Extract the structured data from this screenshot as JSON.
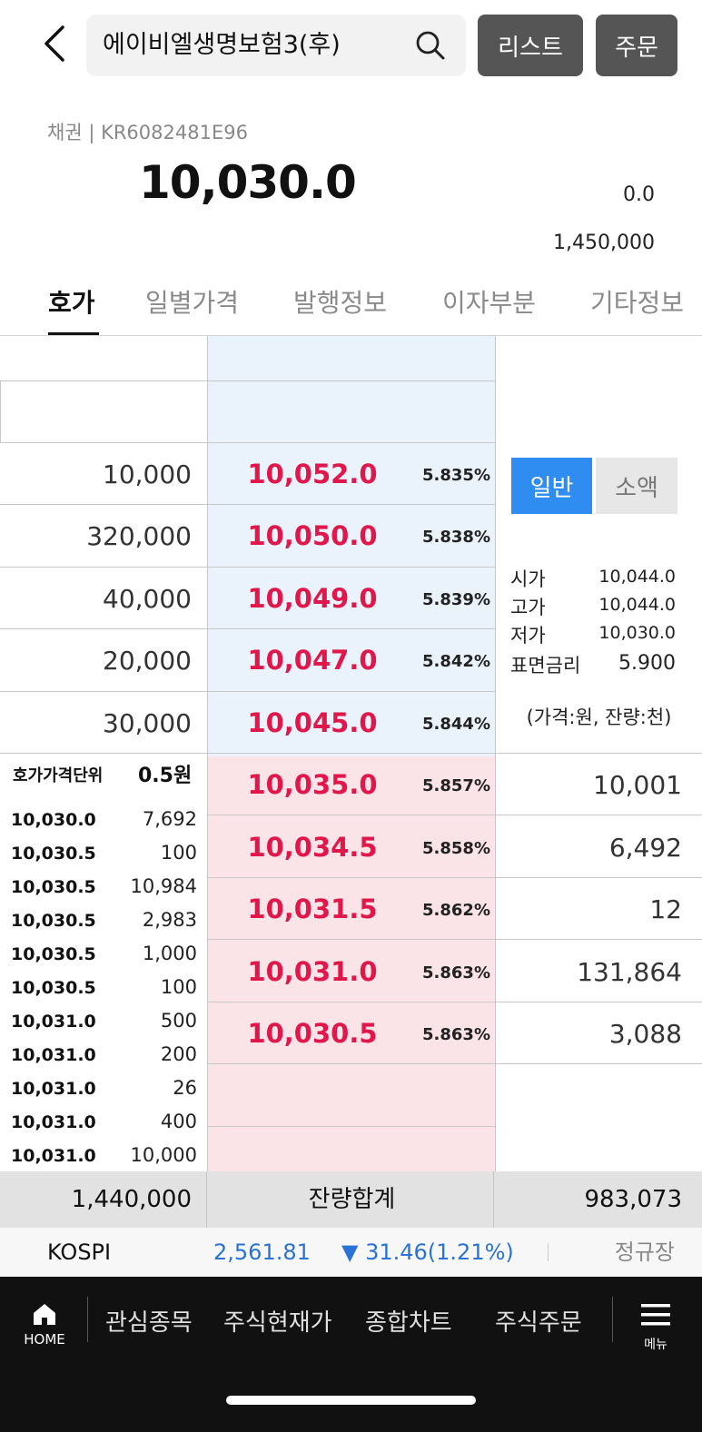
{
  "header": {
    "search_text": "에이비엘생명보험3(후)",
    "list_label": "리스트",
    "order_label": "주문"
  },
  "security": {
    "type_code": "채권 | KR6082481E96",
    "price": "10,030.0",
    "change": "0.0",
    "volume": "1,450,000"
  },
  "tabs": [
    {
      "label": "호가",
      "active": true
    },
    {
      "label": "일별가격",
      "active": false
    },
    {
      "label": "발행정보",
      "active": false
    },
    {
      "label": "이자부분",
      "active": false
    },
    {
      "label": "기타정보",
      "active": false
    }
  ],
  "asks": [
    {
      "qty": "10,000",
      "price": "10,052.0",
      "yield": "5.835%"
    },
    {
      "qty": "320,000",
      "price": "10,050.0",
      "yield": "5.838%"
    },
    {
      "qty": "40,000",
      "price": "10,049.0",
      "yield": "5.839%"
    },
    {
      "qty": "20,000",
      "price": "10,047.0",
      "yield": "5.842%"
    },
    {
      "qty": "30,000",
      "price": "10,045.0",
      "yield": "5.844%"
    }
  ],
  "bids": [
    {
      "price": "10,035.0",
      "yield": "5.857%",
      "qty": "10,001"
    },
    {
      "price": "10,034.5",
      "yield": "5.858%",
      "qty": "6,492"
    },
    {
      "price": "10,031.5",
      "yield": "5.862%",
      "qty": "12"
    },
    {
      "price": "10,031.0",
      "yield": "5.863%",
      "qty": "131,864"
    },
    {
      "price": "10,030.5",
      "yield": "5.863%",
      "qty": "3,088"
    }
  ],
  "segment": {
    "normal": "일반",
    "small": "소액"
  },
  "info": [
    {
      "label": "시가",
      "value": "10,044.0"
    },
    {
      "label": "고가",
      "value": "10,044.0"
    },
    {
      "label": "저가",
      "value": "10,030.0"
    },
    {
      "label": "표면금리",
      "value": "5.900"
    }
  ],
  "unit_note": "(가격:원, 잔량:천)",
  "tick": {
    "title": "호가가격단위",
    "unit": "0.5원",
    "trades": [
      {
        "price": "10,030.0",
        "qty": "7,692"
      },
      {
        "price": "10,030.5",
        "qty": "100"
      },
      {
        "price": "10,030.5",
        "qty": "10,984"
      },
      {
        "price": "10,030.5",
        "qty": "2,983"
      },
      {
        "price": "10,030.5",
        "qty": "1,000"
      },
      {
        "price": "10,030.5",
        "qty": "100"
      },
      {
        "price": "10,031.0",
        "qty": "500"
      },
      {
        "price": "10,031.0",
        "qty": "200"
      },
      {
        "price": "10,031.0",
        "qty": "26"
      },
      {
        "price": "10,031.0",
        "qty": "400"
      },
      {
        "price": "10,031.0",
        "qty": "10,000"
      }
    ]
  },
  "totals": {
    "ask_total": "1,440,000",
    "label": "잔량합계",
    "bid_total": "983,073"
  },
  "index": {
    "name": "KOSPI",
    "value": "2,561.81",
    "change": "▼ 31.46(1.21%)",
    "session": "정규장"
  },
  "nav": {
    "home": "HOME",
    "items": [
      "관심종목",
      "주식현재가",
      "종합차트",
      "주식주문"
    ],
    "menu": "메뉴"
  },
  "colors": {
    "ask_bg": "#eaf3fc",
    "bid_bg": "#fbe4e8",
    "price_red": "#e0174a",
    "accent_blue": "#2f8cf0",
    "index_blue": "#2a73d6"
  }
}
